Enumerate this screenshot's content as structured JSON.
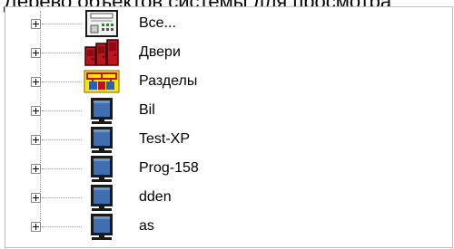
{
  "panel_title": "Дерево объектов системы для просмотра",
  "tree_items": [
    {
      "label": "Все...",
      "icon": "control-panel-icon"
    },
    {
      "label": "Двери",
      "icon": "doors-icon"
    },
    {
      "label": "Разделы",
      "icon": "sections-icon"
    },
    {
      "label": "Bil",
      "icon": "computer-monitor-icon"
    },
    {
      "label": "Test-XP",
      "icon": "computer-monitor-icon"
    },
    {
      "label": "Prog-158",
      "icon": "computer-monitor-icon"
    },
    {
      "label": "dden",
      "icon": "computer-monitor-icon"
    },
    {
      "label": "as",
      "icon": "computer-monitor-icon"
    }
  ],
  "colors": {
    "doors": "#c1121f",
    "sections": "#ffe600",
    "monitor_screen": "#3f6fb0",
    "monitor_frame": "#1a1a1a"
  }
}
